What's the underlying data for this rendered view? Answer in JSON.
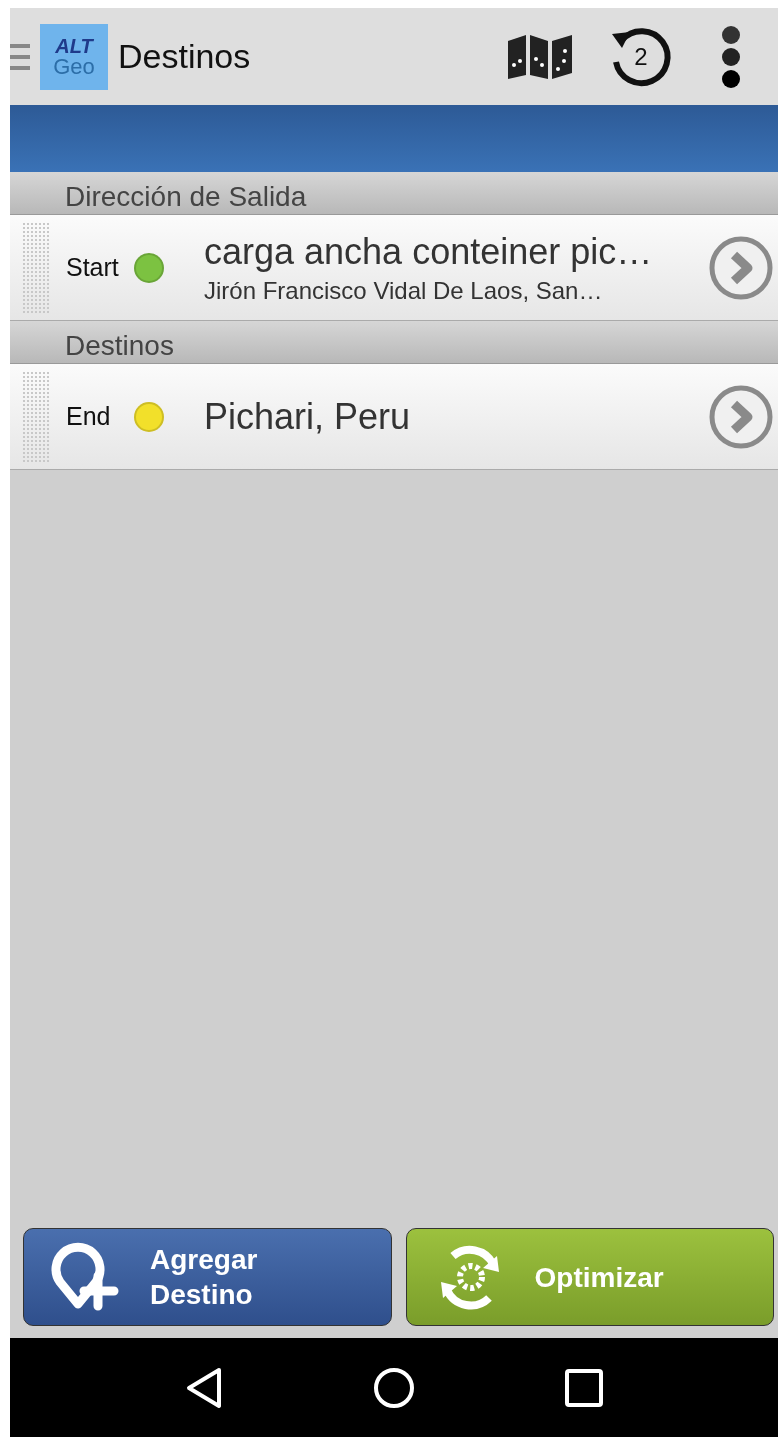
{
  "toolbar": {
    "logo": {
      "line_1": "ALT",
      "line_2": "Geo"
    },
    "title": "Destinos",
    "history_count": "2"
  },
  "sections": [
    {
      "header": "Dirección de Salida",
      "items": [
        {
          "label": "Start",
          "color": "#7cc241",
          "title": "carga ancha conteiner pic…",
          "subtitle": "Jirón Francisco Vidal De Laos, San…"
        }
      ]
    },
    {
      "header": "Destinos",
      "items": [
        {
          "label": "End",
          "color": "#f2e02a",
          "title": "Pichari, Peru"
        }
      ]
    }
  ],
  "buttons": [
    {
      "kind": "add",
      "label_1": "Agregar",
      "label_2": "Destino"
    },
    {
      "kind": "optimize",
      "label_1": "Optimizar"
    }
  ]
}
